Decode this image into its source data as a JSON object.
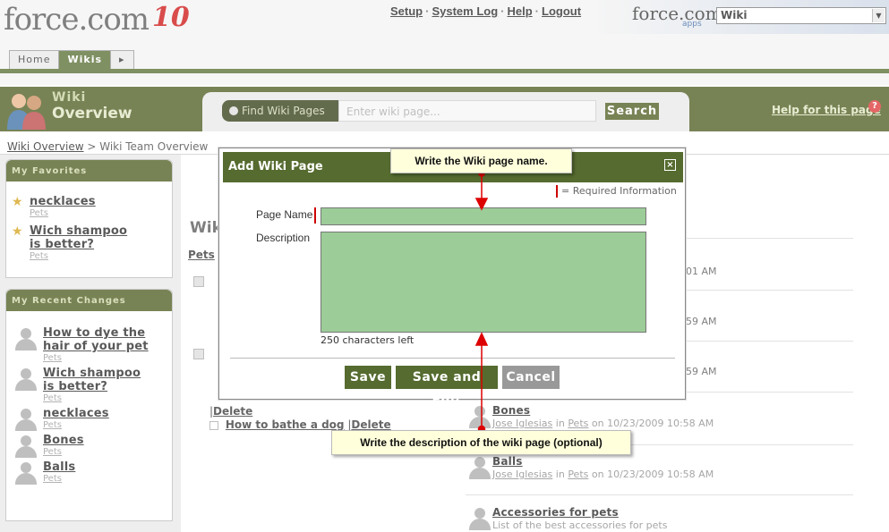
{
  "header": {
    "logo_text": "force.com",
    "logo_suffix": "10",
    "links": [
      "Setup",
      "System Log",
      "Help",
      "Logout"
    ],
    "brand_text": "force.com",
    "brand_sub": "apps",
    "app_select_value": "Wiki"
  },
  "tabs": [
    {
      "label": "Home"
    },
    {
      "label": "Wikis"
    },
    {
      "label": "▸"
    }
  ],
  "band": {
    "title_line1": "Wiki",
    "title_line2": "Overview",
    "find_label": "Find Wiki Pages",
    "search_placeholder": "Enter wiki page...",
    "search_button": "Search",
    "help_link": "Help for this page",
    "help_icon": "?"
  },
  "breadcrumb": {
    "link": "Wiki Overview",
    "separator": " > ",
    "current": "Wiki Team Overview"
  },
  "sidebar": {
    "favorites_title": "My Favorites",
    "favorites": [
      {
        "title": "necklaces",
        "category": "Pets"
      },
      {
        "title": "Wich shampoo is better?",
        "category": "Pets"
      }
    ],
    "recent_title": "My Recent Changes",
    "recent": [
      {
        "title": "How to dye the hair of your pet",
        "category": "Pets"
      },
      {
        "title": "Wich shampoo is better?",
        "category": "Pets"
      },
      {
        "title": "necklaces",
        "category": "Pets"
      },
      {
        "title": "Bones",
        "category": "Pets"
      },
      {
        "title": "Balls",
        "category": "Pets"
      }
    ]
  },
  "main": {
    "heading_partial": "Wik",
    "section_link": "Pets",
    "times": [
      "01 AM",
      "59 AM",
      "59 AM"
    ],
    "delete_label": "Delete",
    "bathe_link": "How to bathe a dog",
    "entries": [
      {
        "title": "Bones",
        "author": "Jose Iglesias",
        "in": "in",
        "category": "Pets",
        "date": "on 10/23/2009 10:58 AM"
      },
      {
        "title": "Balls",
        "author": "Jose Iglesias",
        "in": "in",
        "category": "Pets",
        "date": "on 10/23/2009 10:58 AM"
      },
      {
        "title": "Accessories for pets",
        "description": "List of the best accessories for pets"
      }
    ]
  },
  "dialog": {
    "title": "Add Wiki Page",
    "close": "×",
    "required_note": "= Required Information",
    "page_name_label": "Page Name",
    "description_label": "Description",
    "chars_left": "250 characters left",
    "buttons": {
      "save": "Save",
      "save_edit": "Save and Edit",
      "cancel": "Cancel"
    }
  },
  "callouts": {
    "name": "Write the Wiki page name.",
    "description": "Write the description of the wiki page (optional)"
  },
  "colors": {
    "brand_green": "#556b2f",
    "band_green": "#4b5a1c",
    "input_green": "#9ccc98",
    "arrow_red": "#dd0000",
    "callout_bg": "#ffffdc"
  }
}
